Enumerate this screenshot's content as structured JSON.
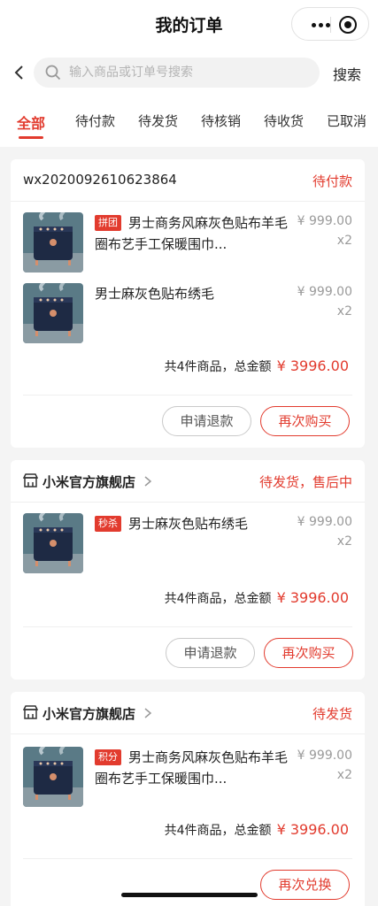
{
  "header": {
    "title": "我的订单"
  },
  "search": {
    "placeholder": "输入商品或订单号搜索",
    "button_label": "搜索"
  },
  "tabs": [
    {
      "label": "全部"
    },
    {
      "label": "待付款"
    },
    {
      "label": "待发货"
    },
    {
      "label": "待核销"
    },
    {
      "label": "待收货"
    },
    {
      "label": "已取消"
    }
  ],
  "orders": [
    {
      "order_no": "wx2020092610623864",
      "status": "待付款",
      "items": [
        {
          "tag": "拼团",
          "title": "男士商务风麻灰色贴布羊毛圈布艺手工保暖围巾...",
          "price": "¥ 999.00",
          "qty": "x2"
        },
        {
          "tag": "",
          "title": "男士麻灰色贴布绣毛",
          "price": "¥ 999.00",
          "qty": "x2"
        }
      ],
      "summary": "共4件商品，总金额",
      "total": "¥ 3996.00",
      "buttons": [
        "申请退款",
        "再次购买"
      ]
    },
    {
      "shop": "小米官方旗舰店",
      "status": "待发货，售后中",
      "items": [
        {
          "tag": "秒杀",
          "title": "男士麻灰色贴布绣毛",
          "price": "¥ 999.00",
          "qty": "x2"
        }
      ],
      "summary": "共4件商品，总金额",
      "total": "¥ 3996.00",
      "buttons": [
        "申请退款",
        "再次购买"
      ]
    },
    {
      "shop": "小米官方旗舰店",
      "status": "待发货",
      "items": [
        {
          "tag": "积分",
          "title": "男士商务风麻灰色贴布羊毛圈布艺手工保暖围巾...",
          "price": "¥ 999.00",
          "qty": "x2"
        }
      ],
      "summary": "共4件商品，总金额",
      "total": "¥ 3996.00",
      "buttons": [
        "再次兑换"
      ]
    }
  ],
  "colors": {
    "accent": "#e23b2e",
    "background": "#f4f4f4"
  },
  "icons": [
    "more-dots-icon",
    "mini-program-close-icon",
    "back-arrow-icon",
    "search-icon",
    "store-icon",
    "chevron-right-icon"
  ]
}
